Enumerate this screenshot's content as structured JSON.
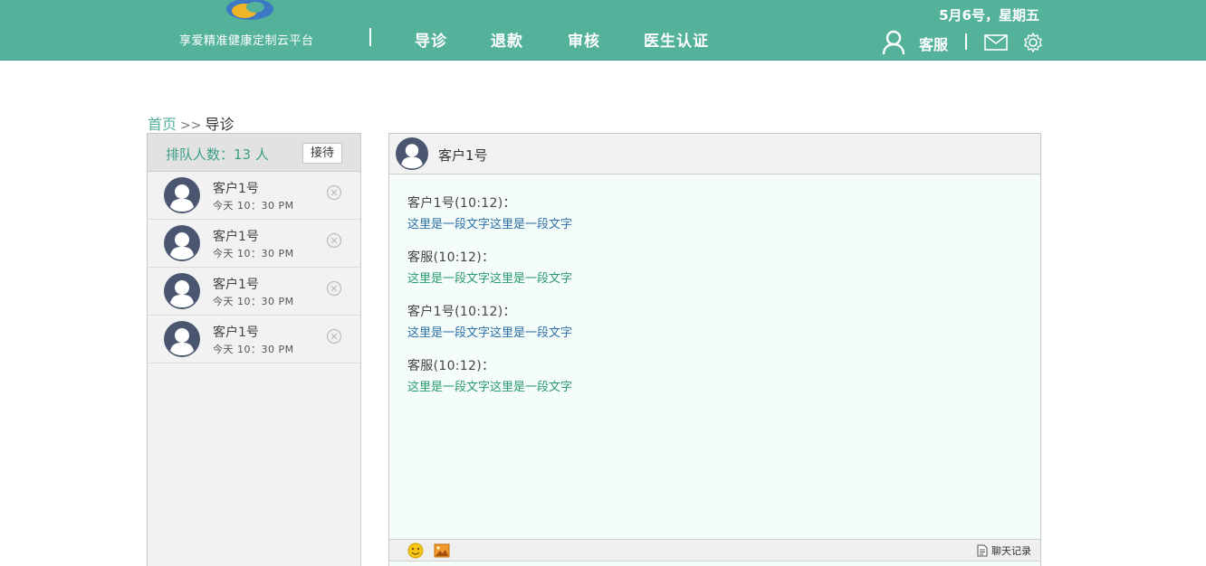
{
  "header": {
    "brand": "享爱精准健康定制云平台",
    "nav": [
      "导诊",
      "退款",
      "审核",
      "医生认证"
    ],
    "date": "5月6号，星期五",
    "user": "客服",
    "icons": [
      "logo",
      "user-icon",
      "mail-icon",
      "gear-icon"
    ],
    "color": "#54b29b"
  },
  "breadcrumb": {
    "home": "首页",
    "separator": ">>",
    "current": "导诊"
  },
  "queue": {
    "title": "排队人数：13 人",
    "accept_label": "接待",
    "items": [
      {
        "name": "客户1号",
        "time": "今天 10：30 PM"
      },
      {
        "name": "客户1号",
        "time": "今天 10：30 PM"
      },
      {
        "name": "客户1号",
        "time": "今天 10：30 PM"
      },
      {
        "name": "客户1号",
        "time": "今天 10：30 PM"
      }
    ]
  },
  "chat": {
    "title": "客户1号",
    "messages": [
      {
        "meta": "客户1号(10:12)：",
        "text": "这里是一段文字这里是一段文字",
        "role": "customer"
      },
      {
        "meta": "客服(10:12)：",
        "text": "这里是一段文字这里是一段文字",
        "role": "agent"
      },
      {
        "meta": "客户1号(10:12)：",
        "text": "这里是一段文字这里是一段文字",
        "role": "customer"
      },
      {
        "meta": "客服(10:12)：",
        "text": "这里是一段文字这里是一段文字",
        "role": "agent"
      }
    ],
    "history_label": "聊天记录",
    "toolbar_icons": [
      "emoji-icon",
      "image-icon",
      "document-icon"
    ]
  }
}
